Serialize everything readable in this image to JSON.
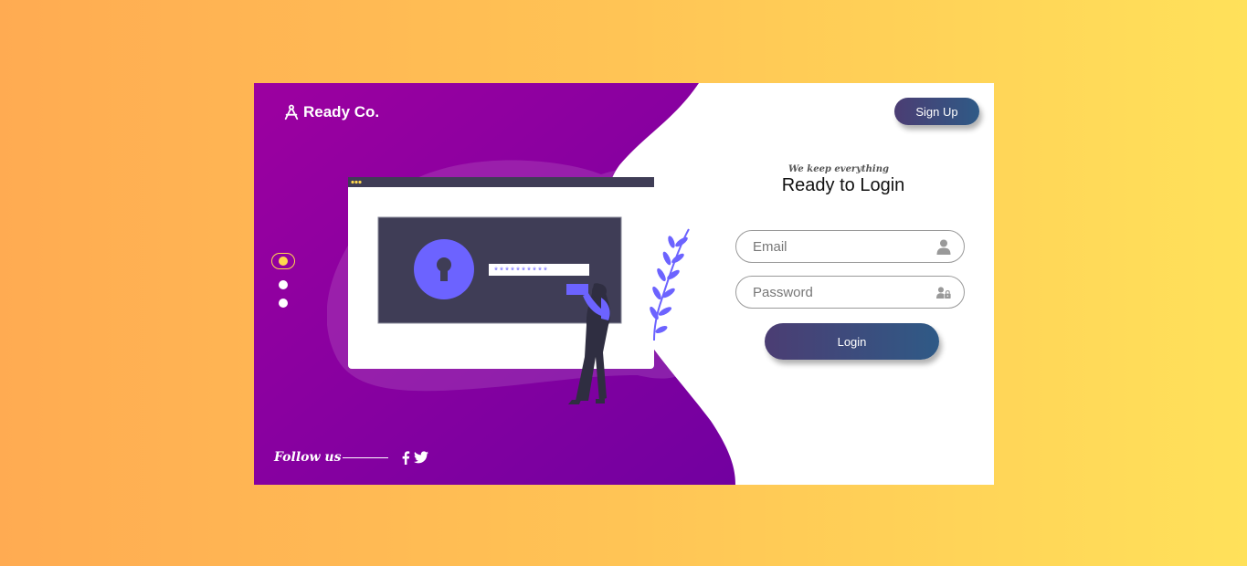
{
  "brand": {
    "name": "Ready Co.",
    "icon": "compass-logo-icon"
  },
  "header": {
    "signup_label": "Sign Up"
  },
  "form": {
    "tagline": "We keep everything",
    "title": "Ready to Login",
    "email_placeholder": "Email",
    "password_placeholder": "Password",
    "login_label": "Login"
  },
  "illustration": {
    "password_mask": "**********"
  },
  "footer": {
    "follow_label": "Follow us",
    "social": [
      "facebook-icon",
      "twitter-icon"
    ]
  },
  "carousel": {
    "slides": 3,
    "active": 1
  },
  "colors": {
    "accent_purple": "#8b00a0",
    "button_gradient_start": "#4b3d73",
    "button_gradient_end": "#2f5a86",
    "active_dot": "#ffd84d",
    "illustration_primary": "#6c63ff"
  }
}
